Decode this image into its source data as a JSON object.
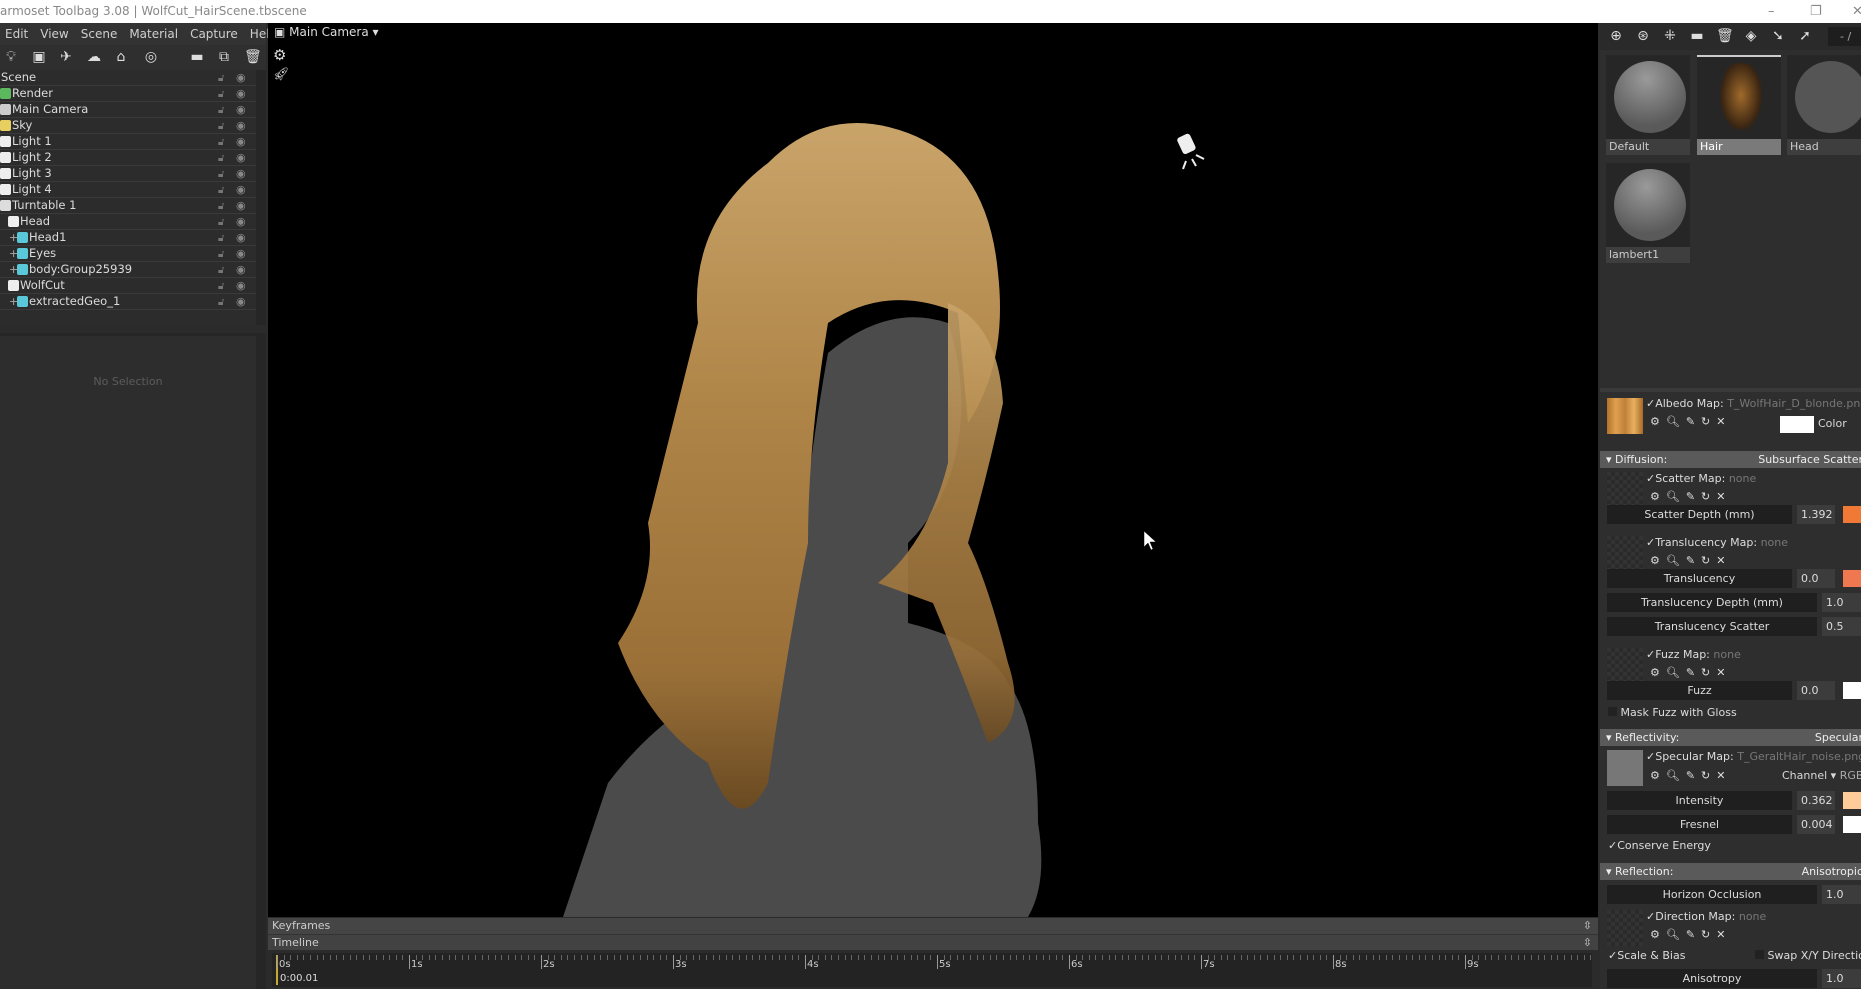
{
  "window": {
    "title": "armoset Toolbag 3.08  |  WolfCut_HairScene.tbscene"
  },
  "menu": [
    "Edit",
    "View",
    "Scene",
    "Material",
    "Capture",
    "Help"
  ],
  "viewport": {
    "camera": "Main Camera"
  },
  "scene_tree": {
    "items": [
      {
        "label": "Scene",
        "icon": "scene",
        "indent": 0
      },
      {
        "label": "Render",
        "icon": "gear-green",
        "indent": 0
      },
      {
        "label": "Main Camera",
        "icon": "camera",
        "indent": 0
      },
      {
        "label": "Sky",
        "icon": "sky",
        "indent": 0
      },
      {
        "label": "Light 1",
        "icon": "bulb",
        "indent": 0
      },
      {
        "label": "Light 2",
        "icon": "bulb",
        "indent": 0
      },
      {
        "label": "Light 3",
        "icon": "bulb",
        "indent": 0
      },
      {
        "label": "Light 4",
        "icon": "bulb",
        "indent": 0
      },
      {
        "label": "Turntable 1",
        "icon": "turntable",
        "indent": 0
      },
      {
        "label": "Head",
        "icon": "group",
        "indent": 1
      },
      {
        "label": "Head1",
        "icon": "mesh",
        "indent": 2
      },
      {
        "label": "Eyes",
        "icon": "mesh",
        "indent": 2
      },
      {
        "label": "body:Group25939",
        "icon": "mesh",
        "indent": 2
      },
      {
        "label": "WolfCut",
        "icon": "group",
        "indent": 1
      },
      {
        "label": "extractedGeo_1",
        "icon": "mesh",
        "indent": 2
      }
    ]
  },
  "selection_panel": {
    "empty_text": "No Selection"
  },
  "timeline": {
    "keyframes_label": "Keyframes",
    "timeline_label": "Timeline",
    "ticks": [
      "0s",
      "1s",
      "2s",
      "3s",
      "4s",
      "5s",
      "6s",
      "7s",
      "8s",
      "9s"
    ],
    "current_time": "0:00.01"
  },
  "materials": {
    "page": "- /",
    "items": [
      {
        "label": "Default",
        "selected": false
      },
      {
        "label": "Hair",
        "selected": true
      },
      {
        "label": "Head",
        "selected": false
      },
      {
        "label": "lambert1",
        "selected": false
      }
    ]
  },
  "properties": {
    "albedo": {
      "label": "Albedo Map:",
      "file": "T_WolfHair_D_blonde.png",
      "color_label": "Color",
      "color": "#ffffff"
    },
    "diffusion": {
      "label": "Diffusion:",
      "mode": "Subsurface Scatter"
    },
    "scatter_map": {
      "label": "Scatter Map:",
      "file": "none"
    },
    "scatter_depth": {
      "label": "Scatter Depth (mm)",
      "value": "1.392",
      "color": "#f07a35"
    },
    "translucency_map": {
      "label": "Translucency Map:",
      "file": "none"
    },
    "translucency": {
      "label": "Translucency",
      "value": "0.0",
      "color": "#f07850"
    },
    "translucency_depth": {
      "label": "Translucency Depth (mm)",
      "value": "1.0"
    },
    "translucency_scatter": {
      "label": "Translucency Scatter",
      "value": "0.5"
    },
    "fuzz_map": {
      "label": "Fuzz Map:",
      "file": "none"
    },
    "fuzz": {
      "label": "Fuzz",
      "value": "0.0",
      "color": "#ffffff"
    },
    "mask_fuzz": {
      "label": "Mask Fuzz with Gloss",
      "checked": false
    },
    "reflectivity": {
      "label": "Reflectivity:",
      "mode": "Specular"
    },
    "specular_map": {
      "label": "Specular Map:",
      "file": "T_GeraltHair_noise.png",
      "channel_label": "Channel",
      "channel": "RGB"
    },
    "intensity": {
      "label": "Intensity",
      "value": "0.362",
      "color": "#ffcc99"
    },
    "fresnel": {
      "label": "Fresnel",
      "value": "0.004",
      "color": "#ffffff"
    },
    "conserve_energy": {
      "label": "Conserve Energy",
      "checked": true
    },
    "reflection": {
      "label": "Reflection:",
      "mode": "Anisotropic"
    },
    "horizon_occlusion": {
      "label": "Horizon Occlusion",
      "value": "1.0"
    },
    "direction_map": {
      "label": "Direction Map:",
      "file": "none"
    },
    "scale_bias": {
      "label": "Scale & Bias",
      "checked": true
    },
    "swap_xy": {
      "label": "Swap X/Y Direction",
      "checked": false
    },
    "anisotropy": {
      "label": "Anisotropy",
      "value": "1.0"
    }
  }
}
